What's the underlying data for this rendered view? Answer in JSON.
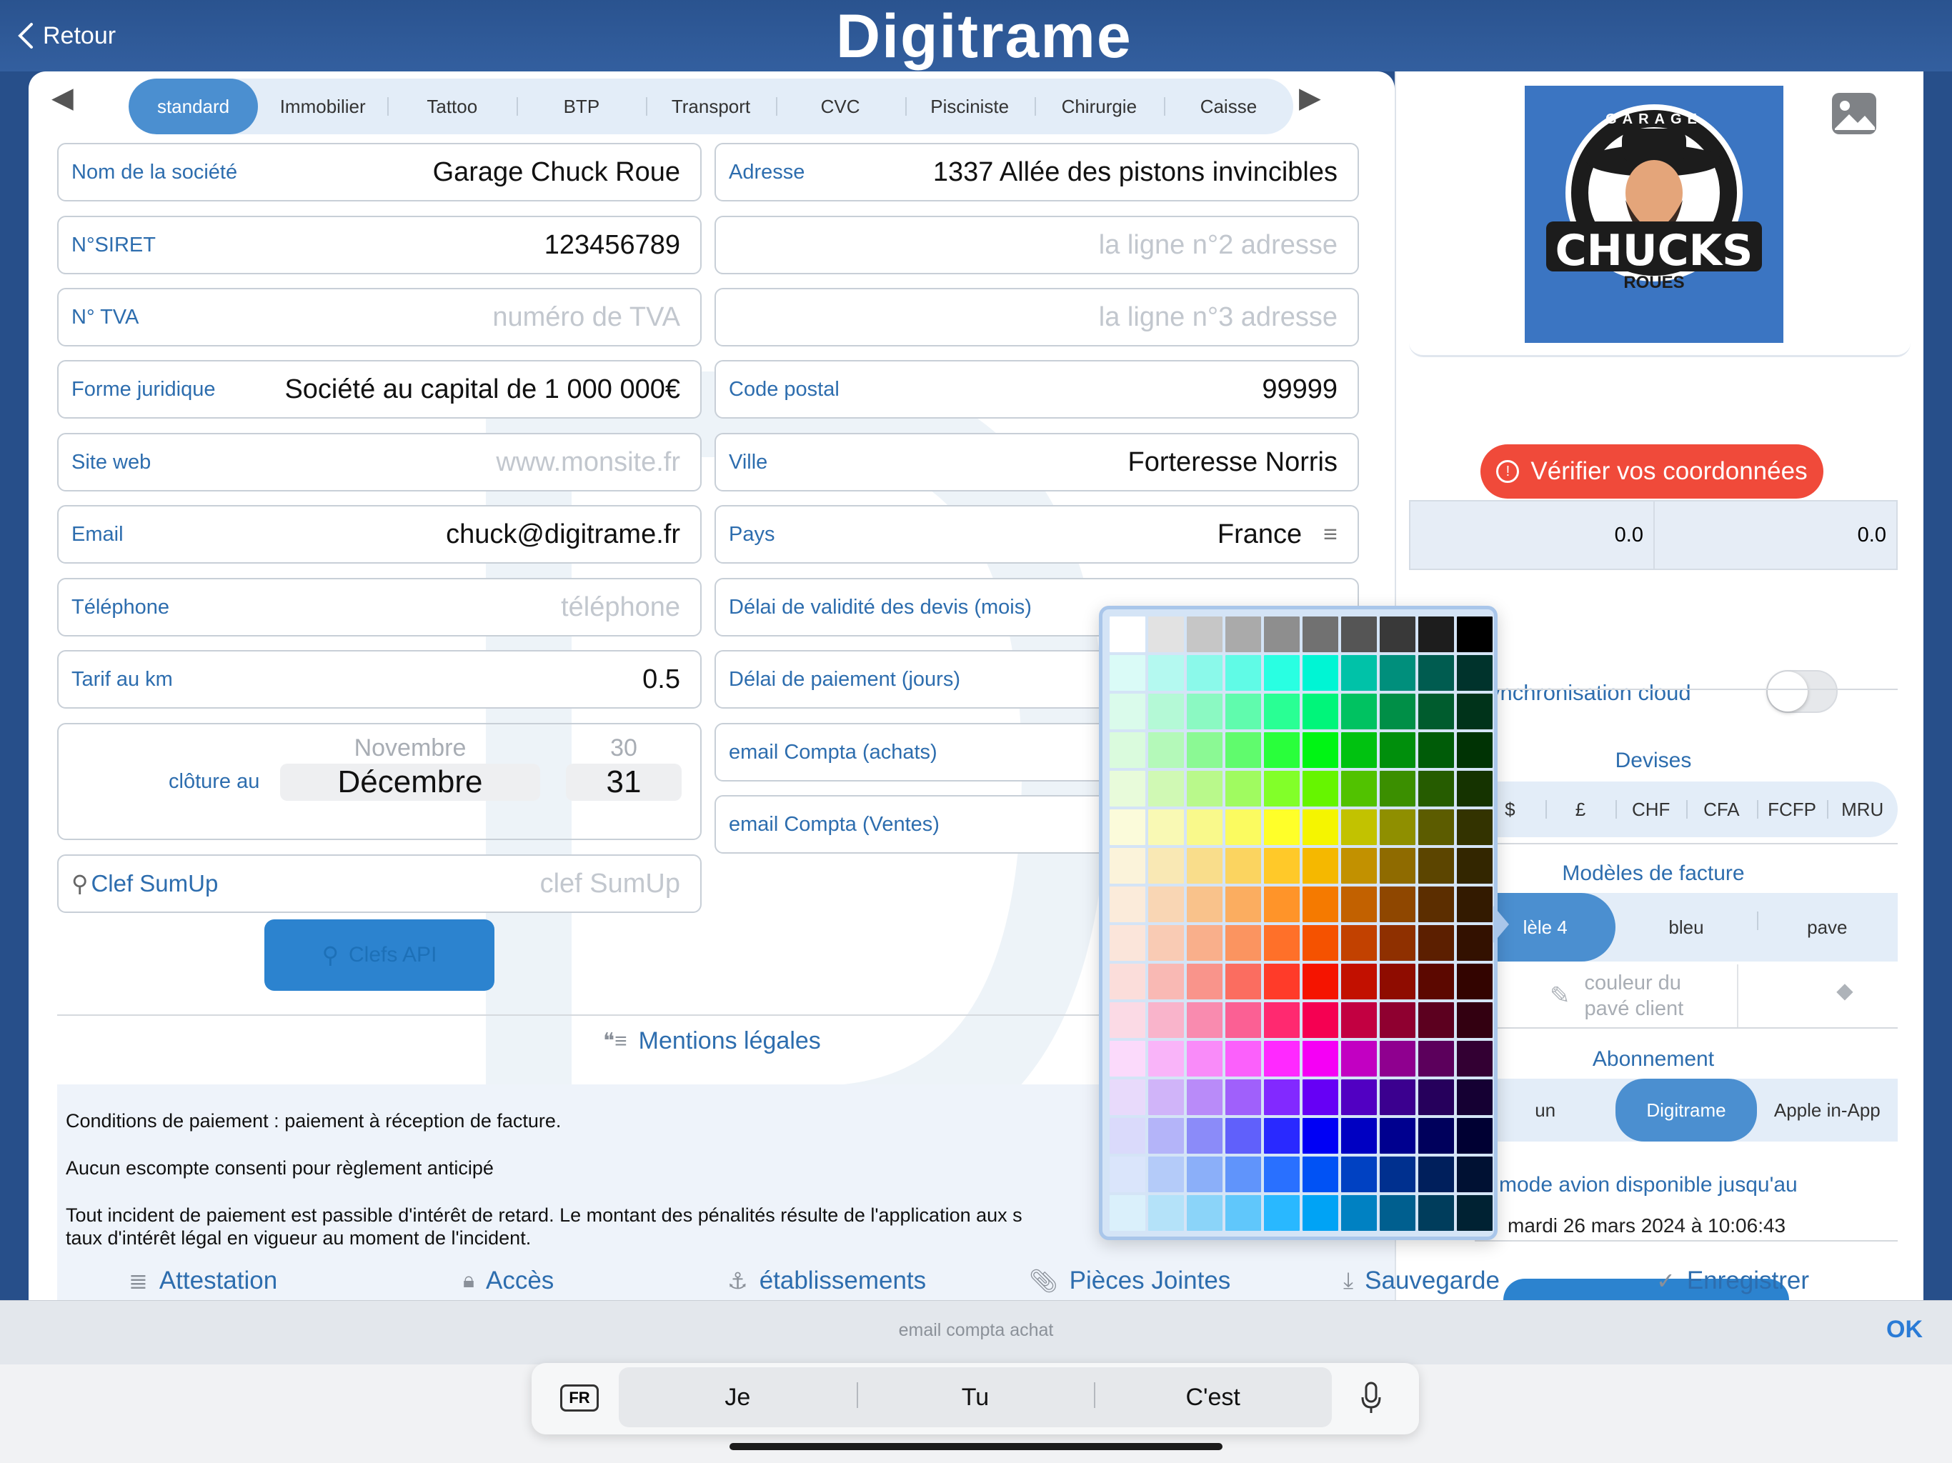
{
  "app": {
    "back_label": "Retour",
    "title": "Digitrame"
  },
  "categories": [
    "standard",
    "Immobilier",
    "Tattoo",
    "BTP",
    "Transport",
    "CVC",
    "Pisciniste",
    "Chirurgie",
    "Caisse"
  ],
  "left_fields": [
    {
      "label": "Nom de la société",
      "value": "Garage Chuck Roue",
      "placeholder": ""
    },
    {
      "label": "N°SIRET",
      "value": "123456789",
      "placeholder": ""
    },
    {
      "label": "N° TVA",
      "value": "",
      "placeholder": "numéro de TVA"
    },
    {
      "label": "Forme juridique",
      "value": "Société au capital de 1 000 000€",
      "placeholder": ""
    },
    {
      "label": "Site web",
      "value": "",
      "placeholder": "www.monsite.fr"
    },
    {
      "label": "Email",
      "value": "chuck@digitrame.fr",
      "placeholder": ""
    },
    {
      "label": "Téléphone",
      "value": "",
      "placeholder": "téléphone"
    },
    {
      "label": "Tarif au km",
      "value": "0.5",
      "placeholder": ""
    }
  ],
  "right_fields": [
    {
      "label": "Adresse",
      "value": "1337 Allée des pistons invincibles",
      "placeholder": ""
    },
    {
      "label": "",
      "value": "",
      "placeholder": "la ligne n°2 adresse"
    },
    {
      "label": "",
      "value": "",
      "placeholder": "la ligne n°3 adresse"
    },
    {
      "label": "Code postal",
      "value": "99999",
      "placeholder": ""
    },
    {
      "label": "Ville",
      "value": "Forteresse Norris",
      "placeholder": ""
    },
    {
      "label": "Pays",
      "value": "France",
      "placeholder": ""
    },
    {
      "label": "Délai de validité des devis (mois)",
      "value": "",
      "placeholder": ""
    },
    {
      "label": "Délai de paiement (jours)",
      "value": "",
      "placeholder": ""
    },
    {
      "label": "email Compta (achats)",
      "value": "",
      "placeholder": ""
    },
    {
      "label": "email Compta (Ventes)",
      "value": "",
      "placeholder": ""
    }
  ],
  "closing": {
    "label": "clôture au",
    "month_prev": "Novembre",
    "month": "Décembre",
    "day_prev": "30",
    "day": "31"
  },
  "sumup": {
    "label": "Clef SumUp",
    "placeholder": "clef SumUp"
  },
  "api_button": "Clefs API",
  "legal": {
    "title": "Mentions légales",
    "lines": [
      "Conditions de paiement : paiement à réception de facture.",
      "Aucun escompte consenti pour règlement anticipé",
      "Tout incident de paiement est passible d'intérêt de retard. Le montant des pénalités résulte de l'application aux s",
      "taux d'intérêt légal en vigueur au moment de l'incident."
    ]
  },
  "toolbar": [
    "Attestation",
    "Accès",
    "établissements",
    "Pièces Jointes",
    "Sauvegarde",
    "Enregistrer"
  ],
  "right_panel": {
    "logo_text": "CHUCKS",
    "logo_arc": "GARAGE",
    "logo_sub": "ROUES",
    "verify_button": "Vérifier vos coordonnées",
    "coords": [
      "0.0",
      "0.0"
    ],
    "sync_label": "ynchronisation cloud",
    "devises_title": "Devises",
    "devises": [
      "$",
      "£",
      "CHF",
      "CFA",
      "FCFP",
      "MRU"
    ],
    "modeles_title": "Modèles de facture",
    "modeles": [
      "lèle 4",
      "bleu",
      "pave"
    ],
    "couleur_label": "couleur du pavé client",
    "abonnement_title": "Abonnement",
    "abonnements": [
      "un",
      "Digitrame",
      "Apple in-App"
    ],
    "mode_avion": "mode avion disponible jusqu'au",
    "date": "mardi 26 mars 2024 à 10:06:43"
  },
  "keyboard": {
    "hint": "email compta achat",
    "ok": "OK",
    "lang": "FR",
    "predictions": [
      "Je",
      "Tu",
      "C'est"
    ]
  },
  "colors": {
    "accent": "#4b8fd0",
    "label": "#2d6dae",
    "verify": "#f04a3a",
    "header": "#2a538f"
  }
}
